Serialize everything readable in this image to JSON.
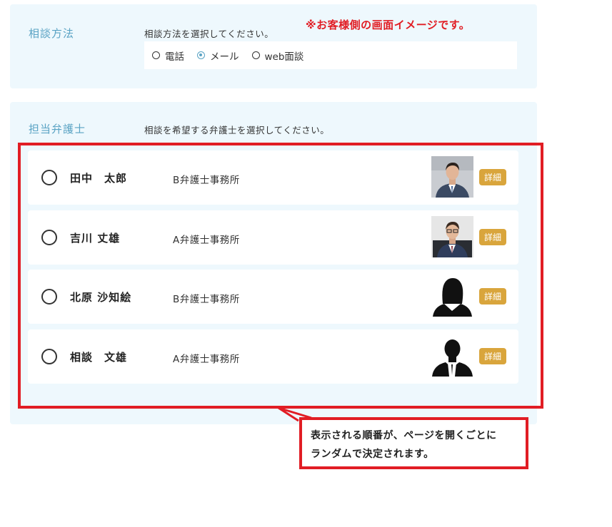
{
  "method": {
    "label": "相談方法",
    "description": "相談方法を選択してください。",
    "notice": "※お客様側の画面イメージです。",
    "options": [
      {
        "label": "電話",
        "checked": false
      },
      {
        "label": "メール",
        "checked": true
      },
      {
        "label": "web面談",
        "checked": false
      }
    ]
  },
  "lawyer": {
    "label": "担当弁護士",
    "description": "相談を希望する弁護士を選択してください。",
    "detail_label": "詳細",
    "items": [
      {
        "name": "田中　太郎",
        "office": "B弁護士事務所",
        "photo": "photo-man-suit"
      },
      {
        "name": "吉川 丈雄",
        "office": "A弁護士事務所",
        "photo": "photo-man-glasses"
      },
      {
        "name": "北原 沙知絵",
        "office": "B弁護士事務所",
        "photo": "silhouette-woman"
      },
      {
        "name": "相談　文雄",
        "office": "A弁護士事務所",
        "photo": "silhouette-man"
      }
    ]
  },
  "callout": {
    "line1": "表示される順番が、ページを開くごとに",
    "line2": "ランダムで決定されます。"
  },
  "colors": {
    "panel_bg": "#eef8fd",
    "accent": "#5aa3c4",
    "highlight_red": "#e11d24",
    "detail_button": "#d9a53c"
  }
}
